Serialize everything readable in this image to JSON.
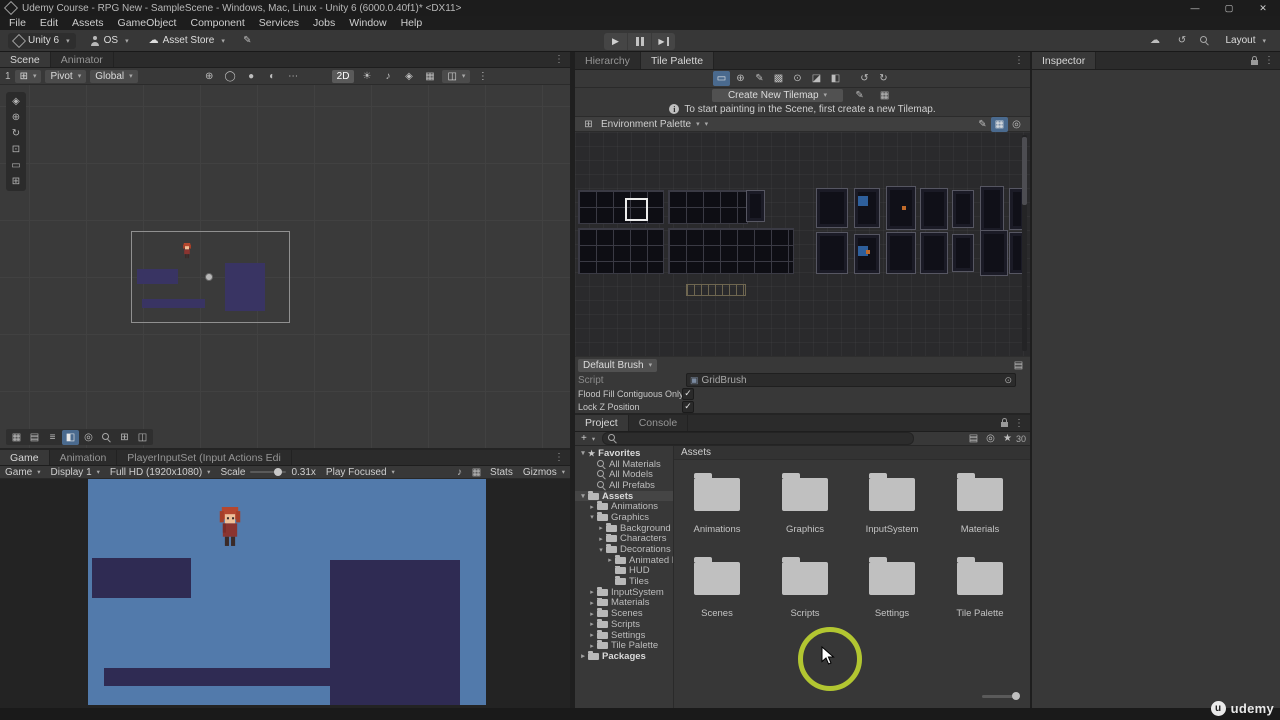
{
  "title_bar": {
    "title": "Udemy Course - RPG New - SampleScene - Windows, Mac, Linux - Unity 6 (6000.0.40f1)* <DX11>"
  },
  "menu_bar": {
    "items": [
      "File",
      "Edit",
      "Assets",
      "GameObject",
      "Component",
      "Services",
      "Jobs",
      "Window",
      "Help"
    ]
  },
  "toolbar": {
    "unity_menu": "Unity 6",
    "account_menu": "OS",
    "asset_store_menu": "Asset Store",
    "layout_menu": "Layout"
  },
  "scene_panel": {
    "tabs": [
      {
        "label": "Scene"
      },
      {
        "label": "Animator"
      }
    ],
    "grid_value": "1",
    "pivot_menu": "Pivot",
    "rotation_menu": "Global",
    "mode_2d": "2D"
  },
  "game_panel": {
    "tabs": [
      {
        "label": "Game"
      },
      {
        "label": "Animation"
      },
      {
        "label": "PlayerInputSet (Input Actions Edi"
      }
    ],
    "view_menu": "Game",
    "display_menu": "Display 1",
    "resolution_menu": "Full HD (1920x1080)",
    "scale_label": "Scale",
    "scale_value": "0.31x",
    "focus_menu": "Play Focused",
    "stats_label": "Stats",
    "gizmos_menu": "Gizmos"
  },
  "tile_palette_panel": {
    "tabs": [
      {
        "label": "Hierarchy"
      },
      {
        "label": "Tile Palette"
      }
    ],
    "create_button": "Create New Tilemap",
    "info_text": "To start painting in the Scene, first create a new Tilemap.",
    "palette_menu": "Environment Palette",
    "brush_menu": "Default Brush",
    "script_label": "Script",
    "script_value": "GridBrush",
    "options": [
      {
        "label": "Flood Fill Contiguous Only",
        "state": "✓"
      },
      {
        "label": "Lock Z Position",
        "state": "✓"
      }
    ]
  },
  "project_panel": {
    "tabs": [
      {
        "label": "Project"
      },
      {
        "label": "Console"
      }
    ],
    "breadcrumb": "Assets",
    "item_count": "30",
    "tree": [
      {
        "label": "Favorites",
        "arrow": "▾"
      },
      {
        "label": "All Materials",
        "arrow": ""
      },
      {
        "label": "All Models",
        "arrow": ""
      },
      {
        "label": "All Prefabs",
        "arrow": ""
      },
      {
        "label": "Assets",
        "arrow": "▾"
      },
      {
        "label": "Animations",
        "arrow": "▸"
      },
      {
        "label": "Graphics",
        "arrow": "▾"
      },
      {
        "label": "Background",
        "arrow": "▸"
      },
      {
        "label": "Characters",
        "arrow": "▸"
      },
      {
        "label": "Decorations",
        "arrow": "▾"
      },
      {
        "label": "Animated E",
        "arrow": "▸"
      },
      {
        "label": "HUD",
        "arrow": ""
      },
      {
        "label": "Tiles",
        "arrow": ""
      },
      {
        "label": "InputSystem",
        "arrow": "▸"
      },
      {
        "label": "Materials",
        "arrow": "▸"
      },
      {
        "label": "Scenes",
        "arrow": "▸"
      },
      {
        "label": "Scripts",
        "arrow": "▸"
      },
      {
        "label": "Settings",
        "arrow": "▸"
      },
      {
        "label": "Tile Palette",
        "arrow": "▸"
      },
      {
        "label": "Packages",
        "arrow": "▸"
      }
    ],
    "folders": [
      "Animations",
      "Graphics",
      "InputSystem",
      "Materials",
      "Scenes",
      "Scripts",
      "Settings",
      "Tile Palette"
    ]
  },
  "inspector_panel": {
    "tabs": [
      {
        "label": "Inspector"
      }
    ]
  },
  "watermark": {
    "brand": "udemy"
  }
}
